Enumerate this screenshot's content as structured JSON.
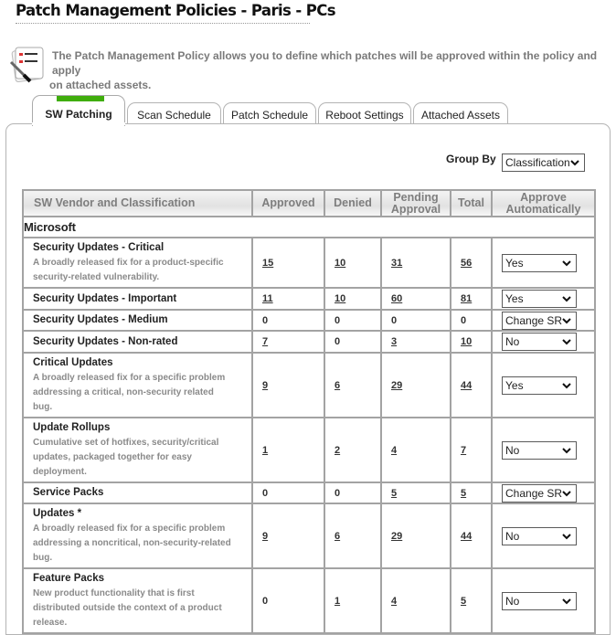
{
  "page": {
    "title": "Patch Management Policies - Paris - PCs",
    "intro_icon": "checklist-pen-icon",
    "intro_line1": "The Patch Management Policy allows you to define which patches will be approved within the policy and apply",
    "intro_line2": "on attached assets."
  },
  "tabs": [
    {
      "label": "SW Patching",
      "active": true
    },
    {
      "label": "Scan Schedule",
      "active": false
    },
    {
      "label": "Patch Schedule",
      "active": false
    },
    {
      "label": "Reboot Settings",
      "active": false
    },
    {
      "label": "Attached Assets",
      "active": false
    }
  ],
  "accent_color": "#3fad0c",
  "group_by": {
    "label": "Group By",
    "selected": "Classification"
  },
  "table": {
    "columns": [
      "SW Vendor and Classification",
      "Approved",
      "Denied",
      "Pending Approval",
      "Total",
      "Approve Automatically"
    ],
    "column_header_lines": {
      "pending_1": "Pending",
      "pending_2": "Approval",
      "auto_1": "Approve",
      "auto_2": "Automatically"
    },
    "vendor": "Microsoft",
    "rows": [
      {
        "name": "Security Updates - Critical",
        "desc1": "A broadly released fix for a product-specific",
        "desc2": "security-related vulnerability.",
        "desc3": "",
        "approved": "15",
        "denied": "10",
        "pending": "31",
        "total": "56",
        "auto": "Yes"
      },
      {
        "name": "Security Updates - Important",
        "desc1": "",
        "desc2": "",
        "desc3": "",
        "approved": "11",
        "denied": "10",
        "pending": "60",
        "total": "81",
        "auto": "Yes"
      },
      {
        "name": "Security Updates - Medium",
        "desc1": "",
        "desc2": "",
        "desc3": "",
        "approved": "0",
        "denied": "0",
        "pending": "0",
        "total": "0",
        "auto": "Change SR"
      },
      {
        "name": "Security Updates - Non-rated",
        "desc1": "",
        "desc2": "",
        "desc3": "",
        "approved": "7",
        "denied": "0",
        "pending": "3",
        "total": "10",
        "auto": "No"
      },
      {
        "name": "Critical Updates",
        "desc1": "A broadly released fix for a specific problem",
        "desc2": "addressing a critical, non-security related",
        "desc3": "bug.",
        "approved": "9",
        "denied": "6",
        "pending": "29",
        "total": "44",
        "auto": "Yes"
      },
      {
        "name": "Update Rollups",
        "desc1": "Cumulative set of hotfixes, security/critical",
        "desc2": "updates, packaged together for easy",
        "desc3": "deployment.",
        "approved": "1",
        "denied": "2",
        "pending": "4",
        "total": "7",
        "auto": "No"
      },
      {
        "name": "Service Packs",
        "desc1": "",
        "desc2": "",
        "desc3": "",
        "approved": "0",
        "denied": "0",
        "pending": "5",
        "total": "5",
        "auto": "Change SR"
      },
      {
        "name": "Updates *",
        "desc1": "A broadly released fix for a specific problem",
        "desc2": "addressing a noncritical, non-security-related",
        "desc3": "bug.",
        "approved": "9",
        "denied": "6",
        "pending": "29",
        "total": "44",
        "auto": "No"
      },
      {
        "name": "Feature Packs",
        "desc1": "New product functionality that is first",
        "desc2": "distributed outside the context of a product",
        "desc3": "release.",
        "approved": "0",
        "denied": "1",
        "pending": "4",
        "total": "5",
        "auto": "No"
      }
    ]
  }
}
